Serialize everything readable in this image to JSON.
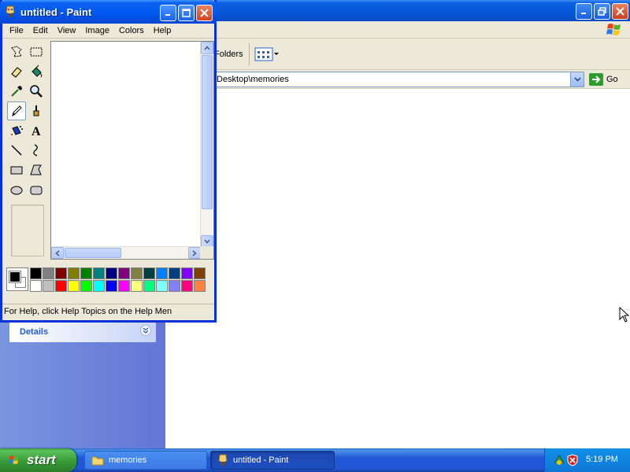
{
  "paint": {
    "title": "untitled - Paint",
    "menu": [
      "File",
      "Edit",
      "View",
      "Image",
      "Colors",
      "Help"
    ],
    "status": "For Help, click Help Topics on the Help Men",
    "palette": [
      "#000000",
      "#808080",
      "#800000",
      "#808000",
      "#008000",
      "#008080",
      "#000080",
      "#800080",
      "#808040",
      "#004040",
      "#0080ff",
      "#004080",
      "#8000ff",
      "#804000",
      "#ffffff",
      "#c0c0c0",
      "#ff0000",
      "#ffff00",
      "#00ff00",
      "#00ffff",
      "#0000ff",
      "#ff00ff",
      "#ffff80",
      "#00ff80",
      "#80ffff",
      "#8080ff",
      "#ff0080",
      "#ff8040"
    ],
    "foreground": "#000000",
    "background": "#ffffff"
  },
  "explorer": {
    "toolbar_folders": "Folders",
    "address": "Desktop\\memories",
    "go_label": "Go",
    "details_label": "Details"
  },
  "taskbar": {
    "start_label": "start",
    "tasks": [
      {
        "label": "memories",
        "active": false
      },
      {
        "label": "untitled - Paint",
        "active": true
      }
    ],
    "clock": "5:19 PM"
  }
}
